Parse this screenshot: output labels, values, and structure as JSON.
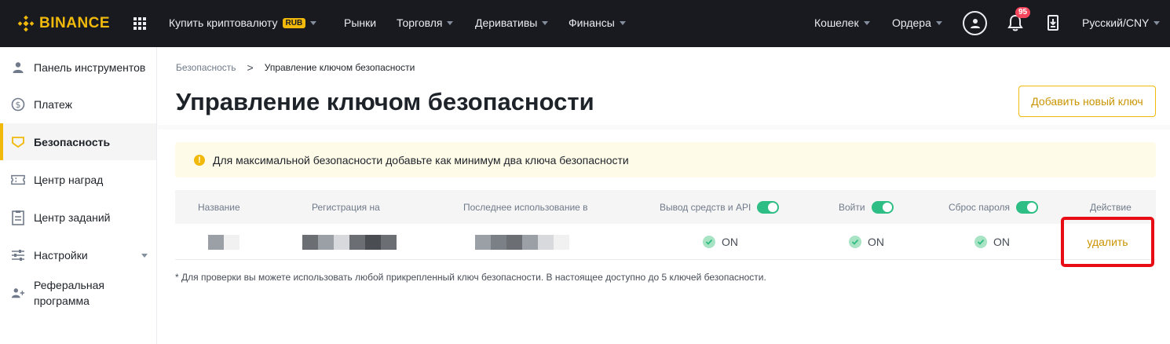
{
  "header": {
    "brand": "BINANCE",
    "nav": [
      {
        "label": "Купить криптовалюту",
        "badge": "RUB"
      },
      {
        "label": "Рынки"
      },
      {
        "label": "Торговля"
      },
      {
        "label": "Деривативы"
      },
      {
        "label": "Финансы"
      }
    ],
    "right": {
      "wallet": "Кошелек",
      "orders": "Ордера",
      "notif_count": "95",
      "locale": "Русский/CNY"
    }
  },
  "sidebar": {
    "items": [
      {
        "label": "Панель инструментов",
        "icon": "user-icon"
      },
      {
        "label": "Платеж",
        "icon": "dollar-circle-icon"
      },
      {
        "label": "Безопасность",
        "icon": "shield-icon",
        "active": true
      },
      {
        "label": "Центр наград",
        "icon": "ticket-icon"
      },
      {
        "label": "Центр заданий",
        "icon": "checklist-icon"
      },
      {
        "label": "Настройки",
        "icon": "sliders-icon"
      },
      {
        "label": "Реферальная программа",
        "label_line1": "Реферальная",
        "label_line2": "программа",
        "icon": "add-user-icon"
      }
    ]
  },
  "breadcrumb": {
    "parent": "Безопасность",
    "separator": ">",
    "current": "Управление ключом безопасности"
  },
  "page": {
    "title": "Управление ключом безопасности",
    "add_button": "Добавить новый ключ",
    "notice": "Для максимальной безопасности добавьте как минимум два ключа безопасности",
    "footnote": "* Для проверки вы можете использовать любой прикрепленный ключ безопасности. В настоящее доступно до 5 ключей безопасности."
  },
  "table": {
    "columns": {
      "name": "Название",
      "registered": "Регистрация на",
      "last_used": "Последнее использование в",
      "withdraw_api": "Вывод средств и API",
      "login": "Войти",
      "reset_password": "Сброс пароля",
      "action": "Действие"
    },
    "row": {
      "withdraw_api": "ON",
      "login": "ON",
      "reset_password": "ON",
      "action": "удалить"
    }
  },
  "colors": {
    "accent": "#F0B90B",
    "toggle_on": "#2EBD85",
    "highlight": "#E80C14"
  }
}
